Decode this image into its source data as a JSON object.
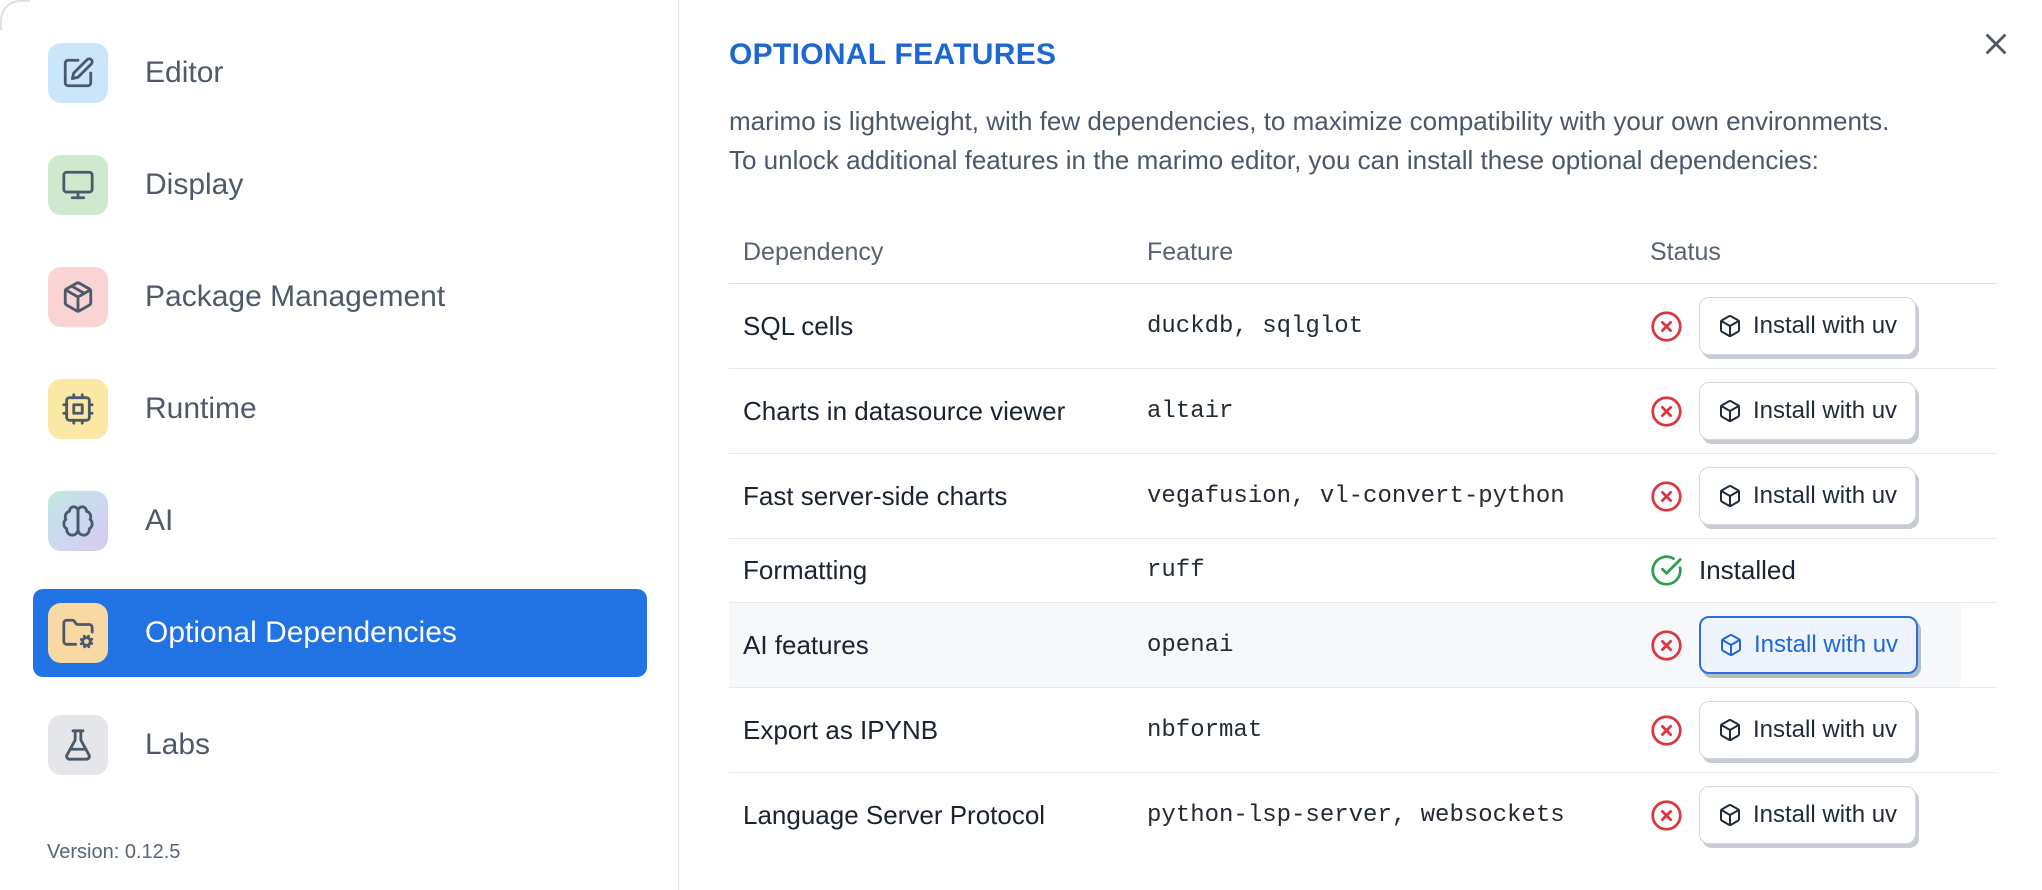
{
  "colors": {
    "title_blue": "#1c67d2",
    "selected_item_blue": "#2173e3",
    "error_red": "#d93842",
    "success_green": "#2f9e4f",
    "accent_button_blue": "#2a6fdb"
  },
  "dialog": {
    "close_icon": "x-icon"
  },
  "sidebar": {
    "items": [
      {
        "label": "Editor",
        "icon": "square-pen",
        "icon_bg": "#cbe5fa",
        "selected": false
      },
      {
        "label": "Display",
        "icon": "monitor",
        "icon_bg": "#cfe9cf",
        "selected": false
      },
      {
        "label": "Package Management",
        "icon": "package",
        "icon_bg": "#fad3d4",
        "selected": false
      },
      {
        "label": "Runtime",
        "icon": "cpu",
        "icon_bg": "#fbe8a4",
        "selected": false
      },
      {
        "label": "AI",
        "icon": "brain",
        "icon_bg": "ai-gradient",
        "selected": false
      },
      {
        "label": "Optional Dependencies",
        "icon": "folder-cog",
        "icon_bg": "#f8d9a3",
        "selected": true
      },
      {
        "label": "Labs",
        "icon": "flask-conical",
        "icon_bg": "#e5e6e9",
        "selected": false
      }
    ],
    "version_label": "Version: 0.12.5"
  },
  "main": {
    "title": "OPTIONAL FEATURES",
    "description_lines": [
      "marimo is lightweight, with few dependencies, to maximize compatibility with your own environments.",
      "To unlock additional features in the marimo editor, you can install these optional dependencies:"
    ],
    "table": {
      "headers": [
        "Dependency",
        "Feature",
        "Status"
      ],
      "install_button_label": "Install with uv",
      "install_button_icon": "box",
      "status_icons": {
        "missing": "circle-x-icon",
        "installed": "circle-check-icon"
      },
      "rows": [
        {
          "dependency": "SQL cells",
          "feature": "duckdb, sqlglot",
          "installed": false,
          "highlighted": false,
          "button_style": "default"
        },
        {
          "dependency": "Charts in datasource viewer",
          "feature": "altair",
          "installed": false,
          "highlighted": false,
          "button_style": "default"
        },
        {
          "dependency": "Fast server-side charts",
          "feature": "vegafusion, vl-convert-python",
          "installed": false,
          "highlighted": false,
          "button_style": "default"
        },
        {
          "dependency": "Formatting",
          "feature": "ruff",
          "installed": true,
          "highlighted": false,
          "status_label": "Installed"
        },
        {
          "dependency": "AI features",
          "feature": "openai",
          "installed": false,
          "highlighted": true,
          "button_style": "accent"
        },
        {
          "dependency": "Export as IPYNB",
          "feature": "nbformat",
          "installed": false,
          "highlighted": false,
          "button_style": "default"
        },
        {
          "dependency": "Language Server Protocol",
          "feature": "python-lsp-server, websockets",
          "installed": false,
          "highlighted": false,
          "button_style": "default"
        }
      ]
    }
  }
}
